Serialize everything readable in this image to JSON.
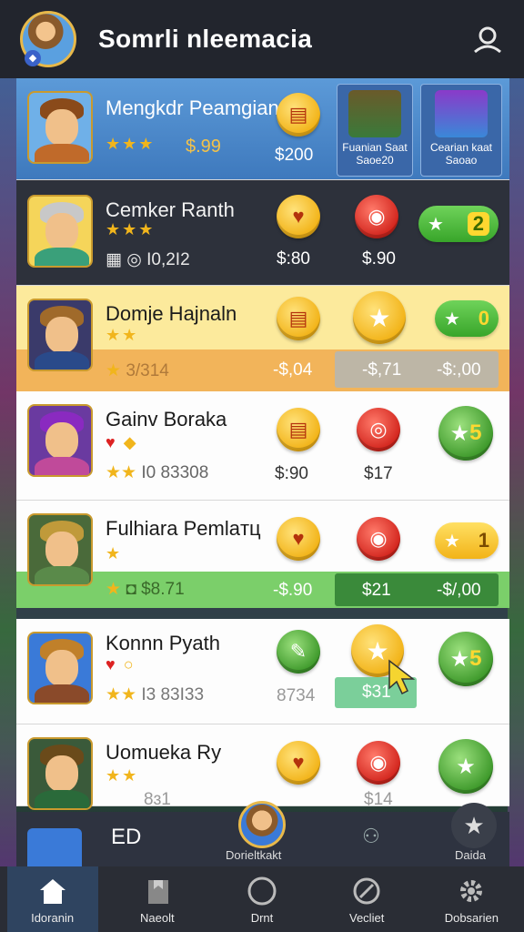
{
  "header": {
    "title": "Somrli nleemacia"
  },
  "rows": [
    {
      "name": "Mengkdr Peamgian",
      "stars_text": "★★★",
      "value": "$.99",
      "price1": "$200",
      "feature_cards": [
        {
          "label": "Fuanian Saat Saoe20"
        },
        {
          "label": "Cearian kaat Saoao"
        }
      ]
    },
    {
      "name": "Cemker Ranth",
      "stars_text": "★★★",
      "value": "I0,2I2",
      "price1": "$:80",
      "price2": "$.90",
      "pill_value": "2"
    },
    {
      "name": "Domje Hajnaln",
      "stars_text": "★★",
      "value": "3/314",
      "price1": "-$,04",
      "price2": "-$,71",
      "price3": "-$:,00",
      "pill_value": "0"
    },
    {
      "name": "Gainv Boraka",
      "stars_text": "★★",
      "value": "I0 83308",
      "price1": "$:90",
      "price2": "$17",
      "pill_value": "5"
    },
    {
      "name": "Fulhiara Pemlaтц",
      "stars_text": "★",
      "value": "$8.71",
      "price1": "-$.90",
      "price2": "$21",
      "price3": "-$/,00",
      "pill_value": "1"
    },
    {
      "name": "Konnn Pyath",
      "stars_text": "★★",
      "value": "I3 83I33",
      "price1": "8734",
      "price2": "$31",
      "pill_value": "5"
    },
    {
      "name": "Uomueka Ry",
      "stars_text": "★★",
      "value": "8ɜ1",
      "price1": "",
      "price2": "$14",
      "pill_value": ""
    }
  ],
  "bottom_strip": {
    "code": "ED",
    "center_label": "Dorieltkakt",
    "right_label": "Daida"
  },
  "nav": [
    {
      "label": "Idoranin",
      "icon": "home-icon"
    },
    {
      "label": "Naeolt",
      "icon": "flag-icon"
    },
    {
      "label": "Drnt",
      "icon": "circle-icon"
    },
    {
      "label": "Vecliet",
      "icon": "wrench-icon"
    },
    {
      "label": "Dobsarien",
      "icon": "gear-icon"
    }
  ],
  "colors": {
    "header_bg": "#22252d",
    "row_highlight_yellow": "#fcea9c",
    "row_strip_orange": "#f2b45a",
    "row_strip_green": "#7bcf6a",
    "accent_gold": "#f2b318"
  }
}
